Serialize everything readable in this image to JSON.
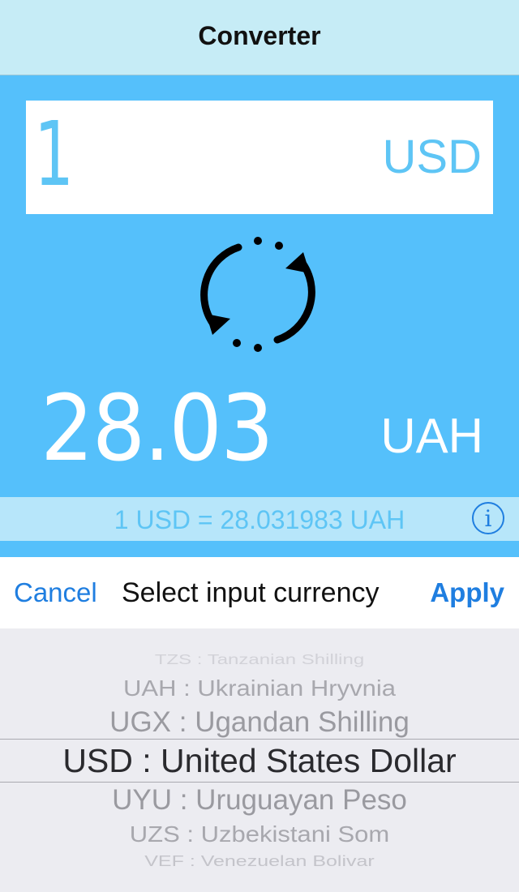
{
  "nav": {
    "title": "Converter"
  },
  "input": {
    "amount": "1",
    "currency": "USD"
  },
  "output": {
    "amount": "28.03",
    "currency": "UAH"
  },
  "rate": {
    "text": "1 USD = 28.031983 UAH"
  },
  "toolbar": {
    "cancel_label": "Cancel",
    "title": "Select input currency",
    "apply_label": "Apply"
  },
  "picker": {
    "items": [
      "TZS : Tanzanian Shilling",
      "UAH : Ukrainian Hryvnia",
      "UGX : Ugandan Shilling",
      "USD : United States Dollar",
      "UYU : Uruguayan Peso",
      "UZS : Uzbekistani Som",
      "VEF : Venezuelan Bolivar"
    ],
    "selected_index": 3
  },
  "colors": {
    "accent_blue": "#55c0fb",
    "link_blue": "#1f7ee0",
    "nav_bg": "#c6ecf6"
  },
  "icons": {
    "swap": "swap-arrows-icon",
    "info": "info-icon"
  }
}
